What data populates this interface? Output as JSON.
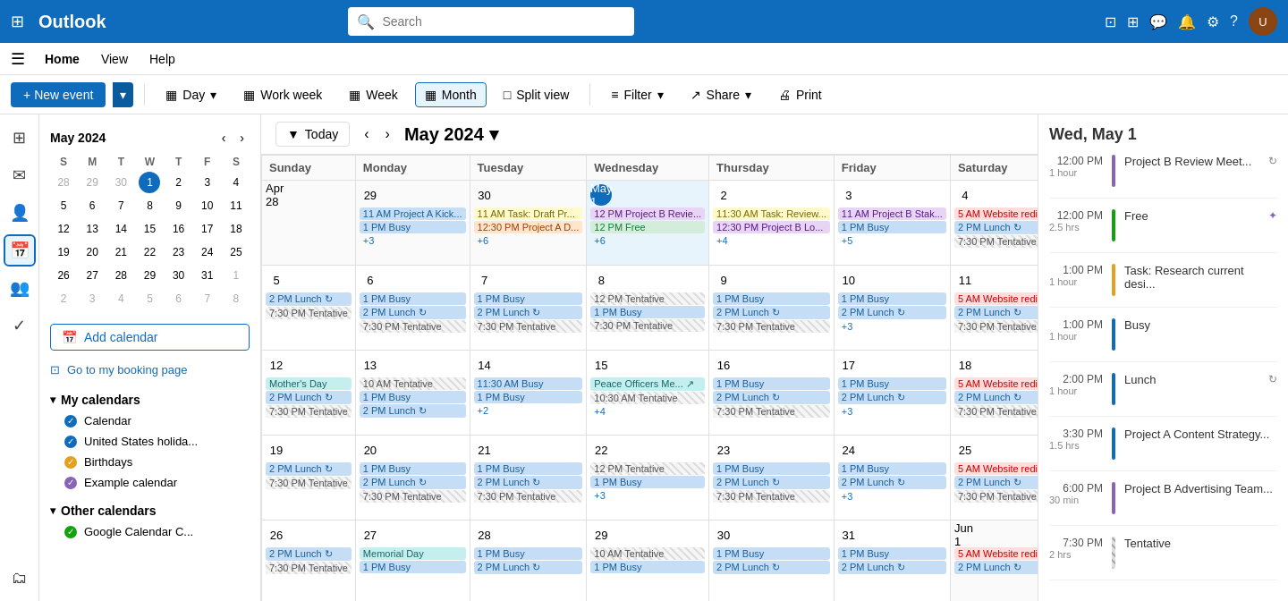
{
  "topbar": {
    "brand": "Outlook",
    "search_placeholder": "Search",
    "waffle_icon": "⊞"
  },
  "menubar": {
    "hamburger": "☰",
    "items": [
      "Home",
      "View",
      "Help"
    ]
  },
  "toolbar": {
    "new_event_label": "New event",
    "buttons": [
      {
        "id": "day",
        "label": "Day",
        "icon": "▦"
      },
      {
        "id": "workweek",
        "label": "Work week",
        "icon": "▦"
      },
      {
        "id": "week",
        "label": "Week",
        "icon": "▦"
      },
      {
        "id": "month",
        "label": "Month",
        "icon": "▦",
        "active": true
      },
      {
        "id": "splitview",
        "label": "Split view",
        "icon": "□"
      },
      {
        "id": "filter",
        "label": "Filter",
        "icon": "≡"
      },
      {
        "id": "share",
        "label": "Share",
        "icon": "↗"
      },
      {
        "id": "print",
        "label": "Print",
        "icon": "🖨"
      }
    ]
  },
  "mini_cal": {
    "title": "May 2024",
    "days_of_week": [
      "S",
      "M",
      "T",
      "W",
      "T",
      "F",
      "S"
    ],
    "weeks": [
      [
        {
          "n": "28",
          "other": true
        },
        {
          "n": "29",
          "other": true
        },
        {
          "n": "30",
          "other": true
        },
        {
          "n": "1",
          "today": true
        },
        {
          "n": "2"
        },
        {
          "n": "3"
        },
        {
          "n": "4"
        }
      ],
      [
        {
          "n": "5"
        },
        {
          "n": "6"
        },
        {
          "n": "7"
        },
        {
          "n": "8"
        },
        {
          "n": "9"
        },
        {
          "n": "10"
        },
        {
          "n": "11"
        }
      ],
      [
        {
          "n": "12"
        },
        {
          "n": "13"
        },
        {
          "n": "14"
        },
        {
          "n": "15"
        },
        {
          "n": "16"
        },
        {
          "n": "17"
        },
        {
          "n": "18"
        }
      ],
      [
        {
          "n": "19"
        },
        {
          "n": "20"
        },
        {
          "n": "21"
        },
        {
          "n": "22"
        },
        {
          "n": "23"
        },
        {
          "n": "24"
        },
        {
          "n": "25"
        }
      ],
      [
        {
          "n": "26"
        },
        {
          "n": "27"
        },
        {
          "n": "28"
        },
        {
          "n": "29"
        },
        {
          "n": "30"
        },
        {
          "n": "31"
        },
        {
          "n": "1",
          "other": true
        }
      ],
      [
        {
          "n": "2",
          "other": true
        },
        {
          "n": "3",
          "other": true
        },
        {
          "n": "4",
          "other": true
        },
        {
          "n": "5",
          "other": true
        },
        {
          "n": "6",
          "other": true
        },
        {
          "n": "7",
          "other": true
        },
        {
          "n": "8",
          "other": true
        }
      ]
    ]
  },
  "sidebar": {
    "add_calendar_label": "Add calendar",
    "booking_label": "Go to my booking page",
    "my_calendars_label": "My calendars",
    "calendars": [
      {
        "name": "Calendar",
        "color": "#0f6cbd",
        "checked": true
      },
      {
        "name": "United States holida...",
        "color": "#0f6cbd",
        "checked": true
      },
      {
        "name": "Birthdays",
        "color": "#e6a020",
        "checked": true
      },
      {
        "name": "Example calendar",
        "color": "#8764b8",
        "checked": true
      }
    ],
    "other_calendars_label": "Other calendars",
    "other_calendars": [
      {
        "name": "Google Calendar C...",
        "color": "#13a10e",
        "checked": true
      }
    ]
  },
  "cal_nav": {
    "today_label": "Today",
    "month_title": "May 2024"
  },
  "month_grid": {
    "headers": [
      "Sunday",
      "Monday",
      "Tuesday",
      "Wednesday",
      "Thursday",
      "Friday",
      "Saturday"
    ],
    "weeks": [
      {
        "days": [
          {
            "num": "Apr 28",
            "other": true,
            "events": []
          },
          {
            "num": "29",
            "events": [
              {
                "label": "11 AM  Project A Kick...",
                "color": "blue"
              },
              {
                "label": "1 PM  Busy",
                "color": "blue"
              },
              {
                "label": "+3",
                "more": true
              }
            ]
          },
          {
            "num": "30",
            "events": [
              {
                "label": "11 AM  Task: Draft Pr...",
                "color": "yellow-bg"
              },
              {
                "label": "12:30 PM  Project A D...",
                "color": "orange"
              },
              {
                "label": "+6",
                "more": true
              }
            ]
          },
          {
            "num": "May 1",
            "today": true,
            "events": [
              {
                "label": "12 PM  Project B Revie...",
                "color": "purple"
              },
              {
                "label": "12 PM  Free",
                "color": "green"
              },
              {
                "label": "+6",
                "more": true
              }
            ]
          },
          {
            "num": "2",
            "events": [
              {
                "label": "11:30 AM  Task: Review...",
                "color": "yellow-bg"
              },
              {
                "label": "12:30 PM  Project B Lo...",
                "color": "purple"
              },
              {
                "label": "+4",
                "more": true
              }
            ]
          },
          {
            "num": "3",
            "events": [
              {
                "label": "11 AM  Project B Stak...",
                "color": "purple"
              },
              {
                "label": "1 PM  Busy",
                "color": "blue"
              },
              {
                "label": "+5",
                "more": true
              }
            ]
          },
          {
            "num": "4",
            "events": [
              {
                "label": "5 AM  Website redi...",
                "color": "red"
              },
              {
                "label": "2 PM  Lunch",
                "color": "blue"
              },
              {
                "label": "7:30 PM  Tentative",
                "color": "gray"
              }
            ]
          }
        ]
      },
      {
        "days": [
          {
            "num": "5",
            "events": [
              {
                "label": "2 PM  Lunch",
                "color": "blue"
              },
              {
                "label": "7:30 PM  Tentative",
                "color": "gray"
              }
            ]
          },
          {
            "num": "6",
            "events": [
              {
                "label": "1 PM  Busy",
                "color": "blue"
              },
              {
                "label": "2 PM  Lunch",
                "color": "blue"
              },
              {
                "label": "7:30 PM  Tentative",
                "color": "gray"
              }
            ]
          },
          {
            "num": "7",
            "events": [
              {
                "label": "1 PM  Busy",
                "color": "blue"
              },
              {
                "label": "2 PM  Lunch",
                "color": "blue"
              },
              {
                "label": "7:30 PM  Tentative",
                "color": "gray"
              }
            ]
          },
          {
            "num": "8",
            "events": [
              {
                "label": "12 PM  Tentative",
                "color": "gray"
              },
              {
                "label": "1 PM  Busy",
                "color": "blue"
              },
              {
                "label": "7:30 PM  Tentative",
                "color": "gray"
              }
            ]
          },
          {
            "num": "9",
            "events": [
              {
                "label": "1 PM  Busy",
                "color": "blue"
              },
              {
                "label": "2 PM  Lunch",
                "color": "blue"
              },
              {
                "label": "7:30 PM  Tentative",
                "color": "gray"
              }
            ]
          },
          {
            "num": "10",
            "events": [
              {
                "label": "1 PM  Busy",
                "color": "blue"
              },
              {
                "label": "2 PM  Lunch",
                "color": "blue"
              },
              {
                "label": "+3",
                "more": true
              }
            ]
          },
          {
            "num": "11",
            "events": [
              {
                "label": "5 AM  Website redi...",
                "color": "red"
              },
              {
                "label": "2 PM  Lunch",
                "color": "blue"
              },
              {
                "label": "7:30 PM  Tentative",
                "color": "gray"
              }
            ]
          }
        ]
      },
      {
        "days": [
          {
            "num": "12",
            "events": [
              {
                "label": "Mother's Day",
                "color": "teal"
              },
              {
                "label": "2 PM  Lunch",
                "color": "blue"
              },
              {
                "label": "7:30 PM  Tentative",
                "color": "gray"
              }
            ]
          },
          {
            "num": "13",
            "events": [
              {
                "label": "10 AM  Tentative",
                "color": "gray"
              },
              {
                "label": "1 PM  Busy",
                "color": "blue"
              },
              {
                "label": "2 PM  Lunch",
                "color": "blue"
              }
            ]
          },
          {
            "num": "14",
            "events": [
              {
                "label": "11:30 AM  Busy",
                "color": "blue"
              },
              {
                "label": "1 PM  Busy",
                "color": "blue"
              },
              {
                "label": "+2",
                "more": true
              }
            ]
          },
          {
            "num": "15",
            "events": [
              {
                "label": "Peace Officers Me...",
                "color": "teal"
              },
              {
                "label": "10:30 AM  Tentative",
                "color": "gray"
              },
              {
                "label": "+4",
                "more": true
              }
            ]
          },
          {
            "num": "16",
            "events": [
              {
                "label": "1 PM  Busy",
                "color": "blue"
              },
              {
                "label": "2 PM  Lunch",
                "color": "blue"
              },
              {
                "label": "7:30 PM  Tentative",
                "color": "gray"
              }
            ]
          },
          {
            "num": "17",
            "events": [
              {
                "label": "1 PM  Busy",
                "color": "blue"
              },
              {
                "label": "2 PM  Lunch",
                "color": "blue"
              },
              {
                "label": "+3",
                "more": true
              }
            ]
          },
          {
            "num": "18",
            "events": [
              {
                "label": "5 AM  Website redi...",
                "color": "red"
              },
              {
                "label": "2 PM  Lunch",
                "color": "blue"
              },
              {
                "label": "7:30 PM  Tentative",
                "color": "gray"
              }
            ]
          }
        ]
      },
      {
        "days": [
          {
            "num": "19",
            "events": [
              {
                "label": "2 PM  Lunch",
                "color": "blue"
              },
              {
                "label": "7:30 PM  Tentative",
                "color": "gray"
              }
            ]
          },
          {
            "num": "20",
            "events": [
              {
                "label": "1 PM  Busy",
                "color": "blue"
              },
              {
                "label": "2 PM  Lunch",
                "color": "blue"
              },
              {
                "label": "7:30 PM  Tentative",
                "color": "gray"
              }
            ]
          },
          {
            "num": "21",
            "events": [
              {
                "label": "1 PM  Busy",
                "color": "blue"
              },
              {
                "label": "2 PM  Lunch",
                "color": "blue"
              },
              {
                "label": "7:30 PM  Tentative",
                "color": "gray"
              }
            ]
          },
          {
            "num": "22",
            "events": [
              {
                "label": "12 PM  Tentative",
                "color": "gray"
              },
              {
                "label": "1 PM  Busy",
                "color": "blue"
              },
              {
                "label": "+3",
                "more": true
              }
            ]
          },
          {
            "num": "23",
            "events": [
              {
                "label": "1 PM  Busy",
                "color": "blue"
              },
              {
                "label": "2 PM  Lunch",
                "color": "blue"
              },
              {
                "label": "7:30 PM  Tentative",
                "color": "gray"
              }
            ]
          },
          {
            "num": "24",
            "events": [
              {
                "label": "1 PM  Busy",
                "color": "blue"
              },
              {
                "label": "2 PM  Lunch",
                "color": "blue"
              },
              {
                "label": "+3",
                "more": true
              }
            ]
          },
          {
            "num": "25",
            "events": [
              {
                "label": "5 AM  Website redi...",
                "color": "red"
              },
              {
                "label": "2 PM  Lunch",
                "color": "blue"
              },
              {
                "label": "7:30 PM  Tentative",
                "color": "gray"
              }
            ]
          }
        ]
      },
      {
        "days": [
          {
            "num": "26",
            "events": [
              {
                "label": "2 PM  Lunch",
                "color": "blue"
              },
              {
                "label": "7:30 PM  Tentative",
                "color": "gray"
              }
            ]
          },
          {
            "num": "27",
            "events": [
              {
                "label": "Memorial Day",
                "color": "teal"
              },
              {
                "label": "1 PM  Busy",
                "color": "blue"
              }
            ]
          },
          {
            "num": "28",
            "events": [
              {
                "label": "1 PM  Busy",
                "color": "blue"
              },
              {
                "label": "2 PM  Lunch",
                "color": "blue"
              }
            ]
          },
          {
            "num": "29",
            "events": [
              {
                "label": "10 AM  Tentative",
                "color": "gray"
              },
              {
                "label": "1 PM  Busy",
                "color": "blue"
              }
            ]
          },
          {
            "num": "30",
            "events": [
              {
                "label": "1 PM  Busy",
                "color": "blue"
              },
              {
                "label": "2 PM  Lunch",
                "color": "blue"
              }
            ]
          },
          {
            "num": "31",
            "events": [
              {
                "label": "1 PM  Busy",
                "color": "blue"
              },
              {
                "label": "2 PM  Lunch",
                "color": "blue"
              }
            ]
          },
          {
            "num": "Jun 1",
            "other": true,
            "events": [
              {
                "label": "5 AM  Website redi...",
                "color": "red"
              },
              {
                "label": "2 PM  Lunch",
                "color": "blue"
              }
            ]
          }
        ]
      }
    ]
  },
  "right_panel": {
    "date_label": "Wed, May 1",
    "agenda": [
      {
        "time": "12:00 PM",
        "duration": "1 hour",
        "title": "Project B Review Meet...",
        "color": "#8764b8",
        "icon": "↻"
      },
      {
        "time": "12:00 PM",
        "duration": "2.5 hrs",
        "title": "Free",
        "color": "#13a10e",
        "icon": "✦"
      },
      {
        "time": "1:00 PM",
        "duration": "1 hour",
        "title": "Task: Research current desi...",
        "color": "#e6a020",
        "icon": ""
      },
      {
        "time": "1:00 PM",
        "duration": "1 hour",
        "title": "Busy",
        "color": "#0f6cbd",
        "icon": ""
      },
      {
        "time": "2:00 PM",
        "duration": "1 hour",
        "title": "Lunch",
        "color": "#0f6cbd",
        "icon": "↻"
      },
      {
        "time": "3:30 PM",
        "duration": "1.5 hrs",
        "title": "Project A Content Strategy...",
        "color": "#0f6cbd",
        "icon": ""
      },
      {
        "time": "6:00 PM",
        "duration": "30 min",
        "title": "Project B Advertising Team...",
        "color": "#8764b8",
        "icon": ""
      },
      {
        "time": "7:30 PM",
        "duration": "2 hrs",
        "title": "Tentative",
        "color": "#888",
        "icon": ""
      }
    ]
  },
  "left_icons": [
    {
      "icon": "⊞",
      "label": "apps"
    },
    {
      "icon": "📧",
      "label": "mail"
    },
    {
      "icon": "👤",
      "label": "contacts",
      "active": false
    },
    {
      "icon": "📅",
      "label": "calendar",
      "active": true
    },
    {
      "icon": "👥",
      "label": "people"
    },
    {
      "icon": "✓",
      "label": "tasks"
    },
    {
      "icon": "🗂",
      "label": "files"
    }
  ]
}
